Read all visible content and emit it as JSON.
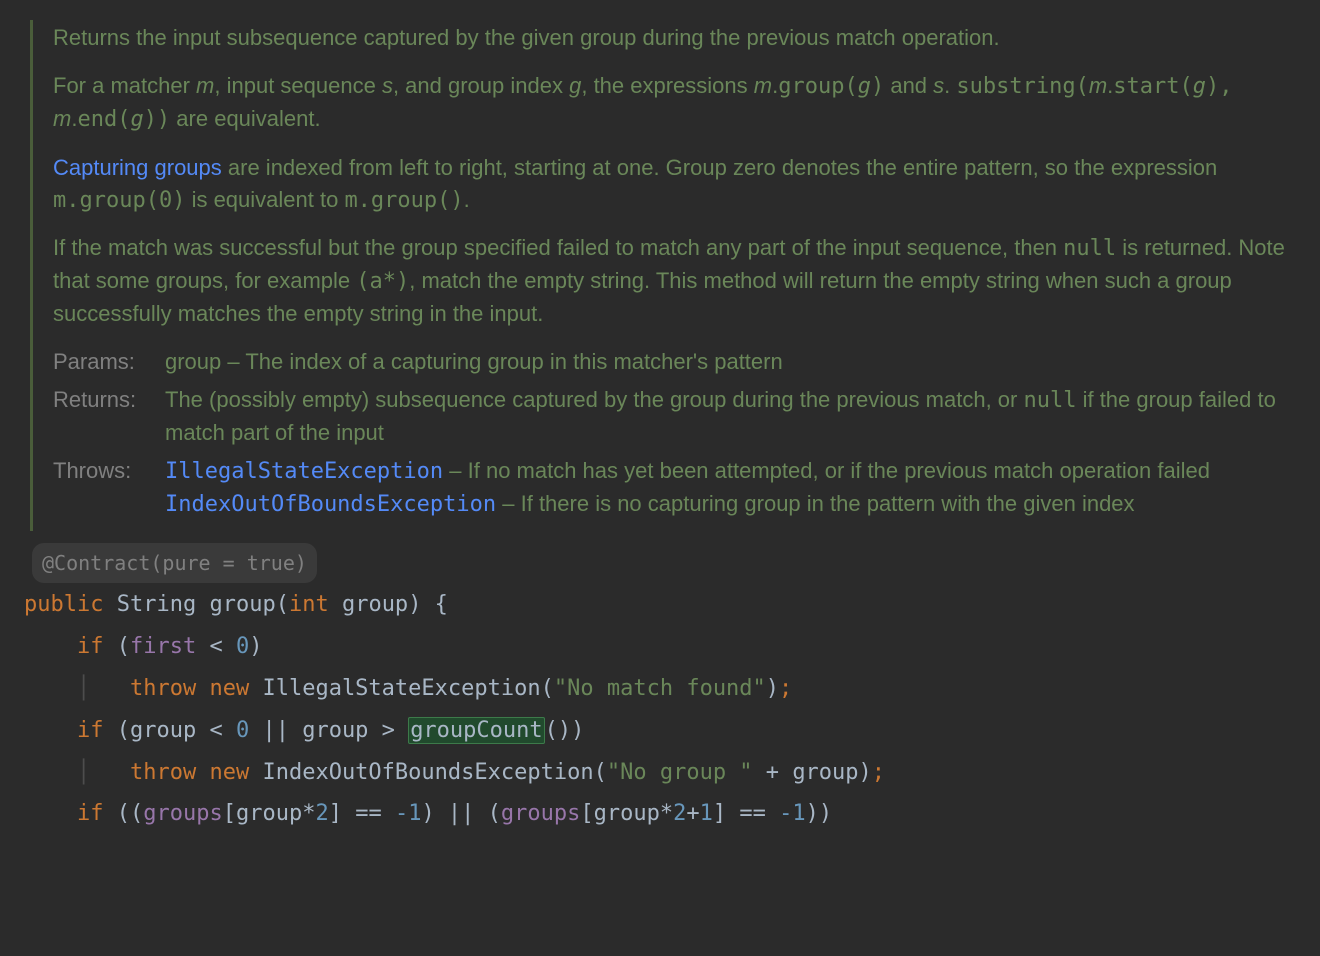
{
  "doc": {
    "p1": "Returns the input subsequence captured by the given group during the previous match operation.",
    "p2a": "For a matcher ",
    "m": "m",
    "p2b": ", input sequence ",
    "s": "s",
    "p2c": ", and group index ",
    "g": "g",
    "p2d": ", the expressions ",
    "groupd": "group(",
    "p2e": ")",
    "p2and": " and ",
    "subopen": "substring(",
    "start": "start(",
    "comma": ", ",
    "end": "end(",
    "close2": "))",
    "p2equiv": " are equivalent.",
    "p3link": "Capturing groups",
    "p3a": " are indexed from left to right, starting at one. Group zero denotes the entire pattern, so the expression ",
    "p3code1": "m.group(0)",
    "p3b": " is equivalent to ",
    "p3code2": "m.group()",
    "p3c": ".",
    "p4a": "If the match was successful but the group specified failed to match any part of the input sequence, then ",
    "p4null": "null",
    "p4b": " is returned. Note that some groups, for example ",
    "p4code": "(a*)",
    "p4c": ", match the empty string. This method will return the empty string when such a group successfully matches the empty string in the input.",
    "paramsLabel": "Params:",
    "paramsBody": "group – The index of a capturing group in this matcher's pattern",
    "returnsLabel": "Returns:",
    "returnsA": "The (possibly empty) subsequence captured by the group during the previous match, or ",
    "returnsNull": "null",
    "returnsB": " if the group failed to match part of the input",
    "throwsLabel": "Throws:",
    "throws1": "IllegalStateException",
    "throws1d": " – If no match has yet been attempted, or if the previous match operation failed",
    "throws2": "IndexOutOfBoundsException",
    "throws2d": " – If there is no capturing group in the pattern with the given index"
  },
  "code": {
    "annotation": "@Contract(pure = true)",
    "kw_public": "public",
    "t_String": "String",
    "m_group": "group",
    "kw_int": "int",
    "p_group": "group",
    "brace_open": " {",
    "kw_if": "if",
    "field_first": "first",
    "lt0": " < ",
    "zero": "0",
    "paren_close": ")",
    "kw_throw": "throw",
    "kw_new": "new",
    "ex1": "IllegalStateException",
    "str1": "\"No match found\"",
    "semi": ";",
    "or": " || ",
    "gt": " > ",
    "groupCount": "groupCount",
    "call": "()",
    "close2": ")",
    "ex2": "IndexOutOfBoundsException",
    "str2": "\"No group \"",
    "plus": " + ",
    "field_groups": "groups",
    "brL": "[",
    "brR": "]",
    "star2": "*",
    "two": "2",
    "eqm1": " == ",
    "m1": "-1",
    "plus1": "+",
    "one": "1"
  }
}
